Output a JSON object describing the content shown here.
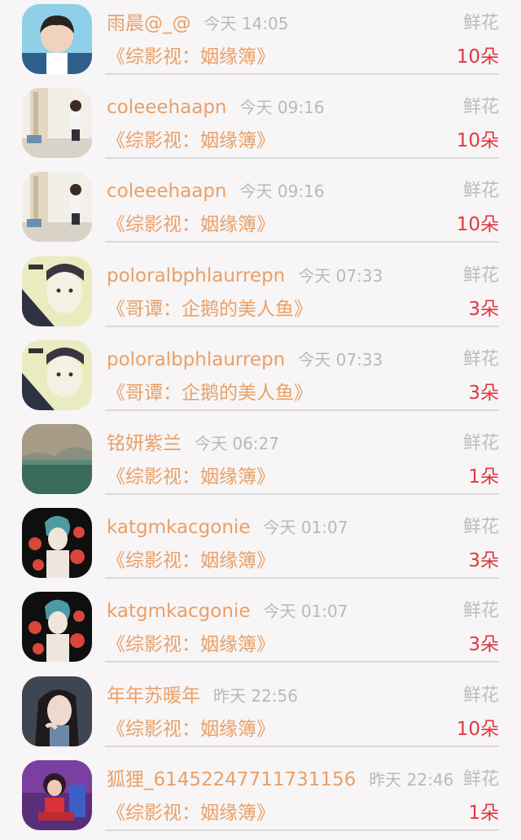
{
  "gifts": [
    {
      "name": "雨晨@_@",
      "time": "今天 14:05",
      "label": "鲜花",
      "book": "《综影视：姻缘簿》",
      "count": "10朵",
      "avatar": "boy-avatar"
    },
    {
      "name": "coleeehaapn",
      "time": "今天 09:16",
      "label": "鲜花",
      "book": "《综影视：姻缘簿》",
      "count": "10朵",
      "avatar": "room-avatar"
    },
    {
      "name": "coleeehaapn",
      "time": "今天 09:16",
      "label": "鲜花",
      "book": "《综影视：姻缘簿》",
      "count": "10朵",
      "avatar": "room-avatar"
    },
    {
      "name": "poloralbphlaurrepn",
      "time": "今天 07:33",
      "label": "鲜花",
      "book": "《哥谭：企鹅的美人鱼》",
      "count": "3朵",
      "avatar": "girl-avatar"
    },
    {
      "name": "poloralbphlaurrepn",
      "time": "今天 07:33",
      "label": "鲜花",
      "book": "《哥谭：企鹅的美人鱼》",
      "count": "3朵",
      "avatar": "girl-avatar"
    },
    {
      "name": "铭妍紫兰",
      "time": "今天 06:27",
      "label": "鲜花",
      "book": "《综影视：姻缘簿》",
      "count": "1朵",
      "avatar": "landscape-avatar"
    },
    {
      "name": "katgmkacgonie",
      "time": "今天 01:07",
      "label": "鲜花",
      "book": "《综影视：姻缘簿》",
      "count": "3朵",
      "avatar": "rose-avatar"
    },
    {
      "name": "katgmkacgonie",
      "time": "今天 01:07",
      "label": "鲜花",
      "book": "《综影视：姻缘簿》",
      "count": "3朵",
      "avatar": "rose-avatar"
    },
    {
      "name": "年年苏暖年",
      "time": "昨天 22:56",
      "label": "鲜花",
      "book": "《综影视：姻缘簿》",
      "count": "10朵",
      "avatar": "woman-avatar"
    },
    {
      "name": "狐狸_61452247711731156",
      "time": "昨天 22:46",
      "label": "鲜花",
      "book": "《综影视：姻缘簿》",
      "count": "1朵",
      "avatar": "cartoon-avatar"
    }
  ]
}
